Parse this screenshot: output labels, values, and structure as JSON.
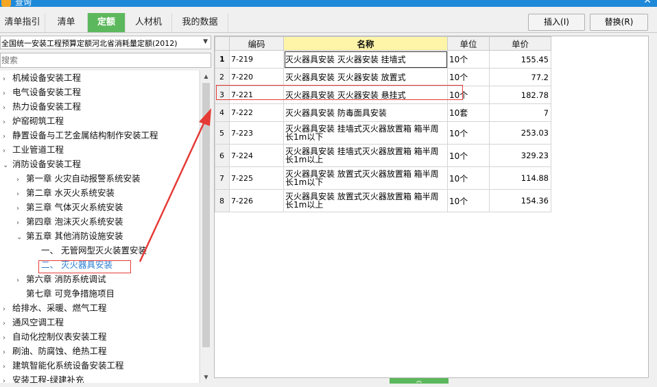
{
  "window": {
    "title": "查询",
    "close_glyph": "✕"
  },
  "tabs": [
    {
      "label": "清单指引",
      "active": false
    },
    {
      "label": "清单",
      "active": false
    },
    {
      "label": "定额",
      "active": true
    },
    {
      "label": "人材机",
      "active": false
    },
    {
      "label": "我的数据",
      "active": false
    }
  ],
  "buttons": {
    "insert": "插入(I)",
    "replace": "替换(R)"
  },
  "quota_select": {
    "value": "全国统一安装工程预算定额河北省消耗量定额(2012)"
  },
  "search": {
    "placeholder": "搜索"
  },
  "tree": [
    {
      "label": "机械设备安装工程",
      "expander": "›"
    },
    {
      "label": "电气设备安装工程",
      "expander": "›"
    },
    {
      "label": "热力设备安装工程",
      "expander": "›"
    },
    {
      "label": "炉窑砌筑工程",
      "expander": "›"
    },
    {
      "label": "静置设备与工艺金属结构制作安装工程",
      "expander": "›"
    },
    {
      "label": "工业管道工程",
      "expander": "›"
    },
    {
      "label": "消防设备安装工程",
      "expander": "⌄"
    },
    {
      "label": "第一章  火灾自动报警系统安装",
      "expander": "›"
    },
    {
      "label": "第二章  水灭火系统安装",
      "expander": "›"
    },
    {
      "label": "第三章  气体灭火系统安装",
      "expander": "›"
    },
    {
      "label": "第四章  泡沫灭火系统安装",
      "expander": "›"
    },
    {
      "label": "第五章  其他消防设施安装",
      "expander": "⌄"
    },
    {
      "label": "一、  无管网型灭火装置安装",
      "expander": ""
    },
    {
      "label": "二、  灭火器具安装",
      "expander": ""
    },
    {
      "label": "第六章  消防系统调试",
      "expander": "›"
    },
    {
      "label": "第七章  可竞争措施项目",
      "expander": ""
    },
    {
      "label": "给排水、采暖、燃气工程",
      "expander": "›"
    },
    {
      "label": "通风空调工程",
      "expander": "›"
    },
    {
      "label": "自动化控制仪表安装工程",
      "expander": "›"
    },
    {
      "label": "刷油、防腐蚀、绝热工程",
      "expander": "›"
    },
    {
      "label": "建筑智能化系统设备安装工程",
      "expander": "›"
    },
    {
      "label": "安装工程-绿建补充",
      "expander": "›"
    }
  ],
  "grid": {
    "headers": {
      "code": "编码",
      "name": "名称",
      "unit": "单位",
      "price": "单价"
    },
    "rows": [
      {
        "no": "1",
        "code": "7-219",
        "name": "灭火器具安装 灭火器安装 挂墙式",
        "unit": "10个",
        "price": "155.45"
      },
      {
        "no": "2",
        "code": "7-220",
        "name": "灭火器具安装 灭火器安装 放置式",
        "unit": "10个",
        "price": "77.2"
      },
      {
        "no": "3",
        "code": "7-221",
        "name": "灭火器具安装 灭火器安装 悬挂式",
        "unit": "10个",
        "price": "182.78"
      },
      {
        "no": "4",
        "code": "7-222",
        "name": "灭火器具安装 防毒面具安装",
        "unit": "10套",
        "price": "7"
      },
      {
        "no": "5",
        "code": "7-223",
        "name": "灭火器具安装 挂墙式灭火器放置箱 箱半周长1m以下",
        "unit": "10个",
        "price": "253.03"
      },
      {
        "no": "6",
        "code": "7-224",
        "name": "灭火器具安装 挂墙式灭火器放置箱 箱半周长1m以上",
        "unit": "10个",
        "price": "329.23"
      },
      {
        "no": "7",
        "code": "7-225",
        "name": "灭火器具安装 放置式灭火器放置箱 箱半周长1m以下",
        "unit": "10个",
        "price": "114.88"
      },
      {
        "no": "8",
        "code": "7-226",
        "name": "灭火器具安装 放置式灭火器放置箱 箱半周长1m以上",
        "unit": "10个",
        "price": "154.36"
      }
    ]
  },
  "colors": {
    "accent": "#5cb85c",
    "title_bar": "#1e88d9",
    "annotation": "#e53935",
    "header_highlight": "#fff5a8"
  }
}
